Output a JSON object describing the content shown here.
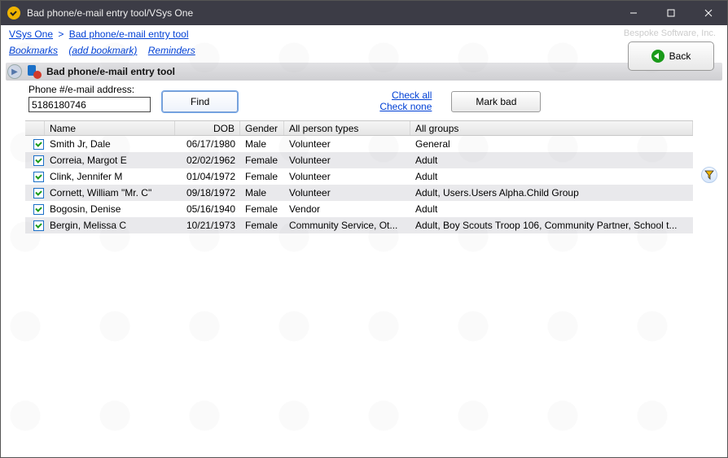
{
  "window": {
    "title": "Bad phone/e-mail entry tool/VSys One"
  },
  "breadcrumbs": {
    "root": "VSys One",
    "current": "Bad phone/e-mail entry tool"
  },
  "vendor_mark": "Bespoke Software, Inc.",
  "links": {
    "bookmarks": "Bookmarks",
    "add_bookmark": "(add bookmark)",
    "reminders": "Reminders"
  },
  "back_button": "Back",
  "section_title": "Bad phone/e-mail entry tool",
  "search": {
    "label": "Phone #/e-mail address:",
    "value": "5186180746",
    "find_label": "Find",
    "check_all": "Check all",
    "check_none": "Check none",
    "mark_bad": "Mark bad"
  },
  "columns": {
    "name": "Name",
    "dob": "DOB",
    "gender": "Gender",
    "types": "All person types",
    "groups": "All groups"
  },
  "rows": [
    {
      "checked": true,
      "name": "Smith Jr, Dale",
      "dob": "06/17/1980",
      "gender": "Male",
      "types": "Volunteer",
      "groups": "General"
    },
    {
      "checked": true,
      "name": "Correia, Margot E",
      "dob": "02/02/1962",
      "gender": "Female",
      "types": "Volunteer",
      "groups": "Adult"
    },
    {
      "checked": true,
      "name": "Clink, Jennifer M",
      "dob": "01/04/1972",
      "gender": "Female",
      "types": "Volunteer",
      "groups": "Adult"
    },
    {
      "checked": true,
      "name": "Cornett, William \"Mr. C\"",
      "dob": "09/18/1972",
      "gender": "Male",
      "types": "Volunteer",
      "groups": "Adult, Users.Users Alpha.Child Group"
    },
    {
      "checked": true,
      "name": "Bogosin, Denise",
      "dob": "05/16/1940",
      "gender": "Female",
      "types": "Vendor",
      "groups": "Adult"
    },
    {
      "checked": true,
      "name": "Bergin, Melissa C",
      "dob": "10/21/1973",
      "gender": "Female",
      "types": "Community Service, Ot...",
      "groups": "Adult, Boy Scouts Troop 106, Community Partner, School t..."
    }
  ]
}
